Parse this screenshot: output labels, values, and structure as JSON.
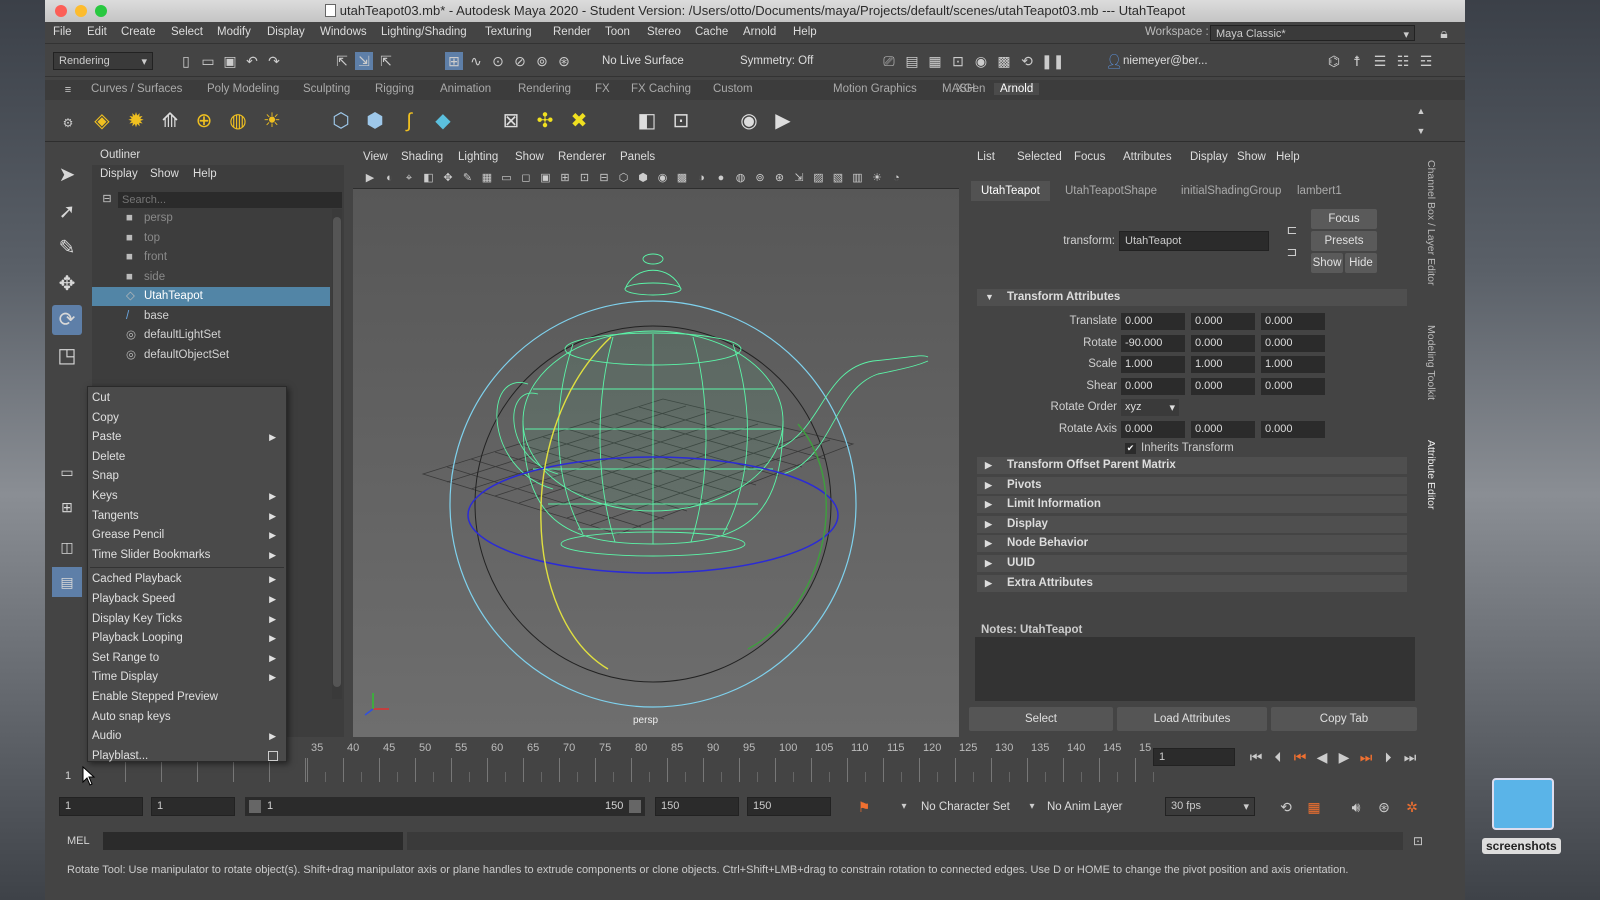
{
  "window": {
    "title": "utahTeapot03.mb* - Autodesk Maya 2020 - Student Version: /Users/otto/Documents/maya/Projects/default/scenes/utahTeapot03.mb  ---  UtahTeapot"
  },
  "menubar": {
    "items": [
      "File",
      "Edit",
      "Create",
      "Select",
      "Modify",
      "Display",
      "Windows",
      "Lighting/Shading",
      "Texturing",
      "Render",
      "Toon",
      "Stereo",
      "Cache",
      "Arnold",
      "Help"
    ],
    "workspace_label": "Workspace :",
    "workspace_value": "Maya Classic*"
  },
  "statusline": {
    "menuset": "Rendering",
    "live_surface": "No Live Surface",
    "symmetry": "Symmetry: Off",
    "user": "niemeyer@ber..."
  },
  "shelf": {
    "tabs": [
      "Curves / Surfaces",
      "Poly Modeling",
      "Sculpting",
      "Rigging",
      "Animation",
      "Rendering",
      "FX",
      "FX Caching",
      "Custom",
      "Motion Graphics",
      "MASH",
      "XGen",
      "Arnold"
    ],
    "active_tab": "Arnold"
  },
  "outliner": {
    "title": "Outliner",
    "menu": [
      "Display",
      "Show",
      "Help"
    ],
    "search_placeholder": "Search...",
    "items": [
      {
        "label": "persp",
        "icon": "camera-icon"
      },
      {
        "label": "top",
        "icon": "camera-icon"
      },
      {
        "label": "front",
        "icon": "camera-icon"
      },
      {
        "label": "side",
        "icon": "camera-icon"
      },
      {
        "label": "UtahTeapot",
        "icon": "mesh-icon",
        "selected": true
      },
      {
        "label": "base",
        "icon": "curve-icon"
      },
      {
        "label": "defaultLightSet",
        "icon": "set-icon"
      },
      {
        "label": "defaultObjectSet",
        "icon": "set-icon"
      }
    ]
  },
  "context_menu": {
    "items": [
      {
        "label": "Cut",
        "sub": false
      },
      {
        "label": "Copy",
        "sub": false
      },
      {
        "label": "Paste",
        "sub": true
      },
      {
        "label": "Delete",
        "sub": false
      },
      {
        "label": "Snap",
        "sub": false
      },
      {
        "label": "Keys",
        "sub": true
      },
      {
        "label": "Tangents",
        "sub": true
      },
      {
        "label": "Grease Pencil",
        "sub": true
      },
      {
        "label": "Time Slider Bookmarks",
        "sub": true
      },
      {
        "label": "Cached Playback",
        "sub": true
      },
      {
        "label": "Playback Speed",
        "sub": true
      },
      {
        "label": "Display Key Ticks",
        "sub": true
      },
      {
        "label": "Playback Looping",
        "sub": true
      },
      {
        "label": "Set Range to",
        "sub": true
      },
      {
        "label": "Time Display",
        "sub": true
      },
      {
        "label": "Enable Stepped Preview",
        "sub": false
      },
      {
        "label": "Auto snap keys",
        "sub": false
      },
      {
        "label": "Audio",
        "sub": true
      },
      {
        "label": "Playblast...",
        "sub": false
      }
    ]
  },
  "viewport": {
    "menu": [
      "View",
      "Shading",
      "Lighting",
      "Show",
      "Renderer",
      "Panels"
    ],
    "camera_label": "persp"
  },
  "attribute_editor": {
    "menu": [
      "List",
      "Selected",
      "Focus",
      "Attributes",
      "Display",
      "Show",
      "Help"
    ],
    "tabs": [
      "UtahTeapot",
      "UtahTeapotShape",
      "initialShadingGroup",
      "lambert1"
    ],
    "transform_label": "transform:",
    "transform_value": "UtahTeapot",
    "buttons": {
      "focus": "Focus",
      "presets": "Presets",
      "show": "Show",
      "hide": "Hide"
    },
    "section_transform": "Transform Attributes",
    "attrs": [
      {
        "label": "Translate",
        "values": [
          "0.000",
          "0.000",
          "0.000"
        ]
      },
      {
        "label": "Rotate",
        "values": [
          "-90.000",
          "0.000",
          "0.000"
        ]
      },
      {
        "label": "Scale",
        "values": [
          "1.000",
          "1.000",
          "1.000"
        ]
      },
      {
        "label": "Shear",
        "values": [
          "0.000",
          "0.000",
          "0.000"
        ]
      }
    ],
    "rotate_order_label": "Rotate Order",
    "rotate_order_value": "xyz",
    "rotate_axis_label": "Rotate Axis",
    "rotate_axis_values": [
      "0.000",
      "0.000",
      "0.000"
    ],
    "inherits_label": "Inherits Transform",
    "collapsed_sections": [
      "Transform Offset Parent Matrix",
      "Pivots",
      "Limit Information",
      "Display",
      "Node Behavior",
      "UUID",
      "Extra Attributes"
    ],
    "notes_label": "Notes:",
    "notes_node": "UtahTeapot",
    "bottom_buttons": [
      "Select",
      "Load Attributes",
      "Copy Tab"
    ]
  },
  "side_tabs": [
    "Channel Box / Layer Editor",
    "Modeling Toolkit",
    "Attribute Editor"
  ],
  "timeline": {
    "ticks": [
      "35",
      "40",
      "45",
      "50",
      "55",
      "60",
      "65",
      "70",
      "75",
      "80",
      "85",
      "90",
      "95",
      "100",
      "105",
      "110",
      "115",
      "120",
      "125",
      "130",
      "135",
      "140",
      "145",
      "15"
    ],
    "current_frame": "1",
    "left_frame": "1"
  },
  "range": {
    "start": "1",
    "anim_start": "1",
    "slider_start": "1",
    "slider_end": "150",
    "end": "150",
    "anim_end": "150",
    "character_set": "No Character Set",
    "anim_layer": "No Anim Layer",
    "fps": "30 fps"
  },
  "cmdline": {
    "lang": "MEL"
  },
  "helpline": {
    "text": "Rotate Tool: Use manipulator to rotate object(s). Shift+drag manipulator axis or plane handles to extrude components or clone objects. Ctrl+Shift+LMB+drag to constrain rotation to connected edges. Use D or HOME to change the pivot position and axis orientation."
  },
  "desktop": {
    "folder_label": "screenshots"
  },
  "colors": {
    "accent": "#4d8fcc",
    "wire": "#5bf5a8",
    "manip_blue": "#2b2bd6",
    "manip_yellow": "#e0e040",
    "manip_cyan": "#7fd2ee"
  }
}
